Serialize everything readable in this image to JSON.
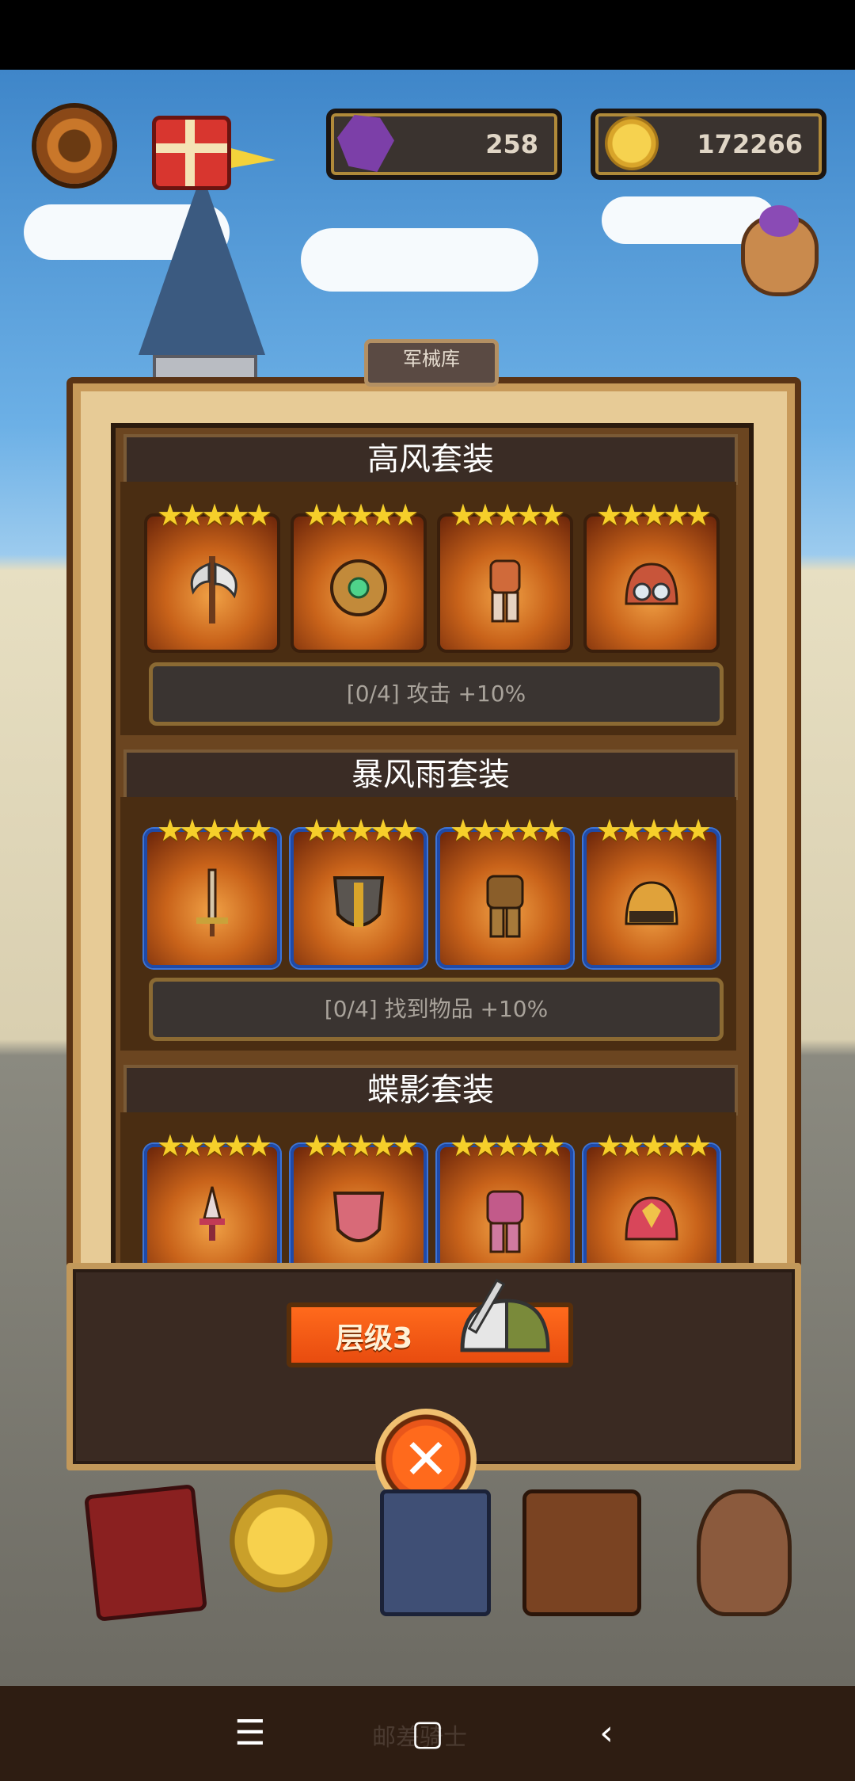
{
  "hud": {
    "gems": "258",
    "coins": "172266",
    "icons": [
      "gear-icon",
      "gift-icon",
      "gem-icon",
      "coin-icon",
      "loot-bag-icon"
    ]
  },
  "armory": {
    "tab_label": "军械库",
    "sets": [
      {
        "name": "高风套装",
        "bonus": "[0/4] 攻击 +10%",
        "items": [
          "axe-icon",
          "shield-icon",
          "armor-icon",
          "goggle-helmet-icon"
        ],
        "stars": "★★★★★"
      },
      {
        "name": "暴风雨套装",
        "bonus": "[0/4] 找到物品 +10%",
        "items": [
          "sword-icon",
          "shield-icon",
          "armor-icon",
          "helmet-icon"
        ],
        "stars": "★★★★★"
      },
      {
        "name": "蝶影套装",
        "items": [
          "dagger-icon",
          "shield-icon",
          "armor-icon",
          "helmet-icon"
        ],
        "stars": "★★★★★"
      }
    ]
  },
  "level": {
    "label": "层级3"
  },
  "bottom_nav": {
    "items": [
      "book-icon",
      "star-medal-icon",
      "spellbook-icon",
      "satchel-icon",
      "treasure-sack-icon"
    ]
  },
  "system_nav": {
    "menu": "☰",
    "home": "▢",
    "back": "‹",
    "watermark": "邮差骑士"
  },
  "colors": {
    "accent_orange": "#ff6a1c",
    "gold_star": "#f6cf2a",
    "slot_blue_border": "#1f4aa8"
  }
}
